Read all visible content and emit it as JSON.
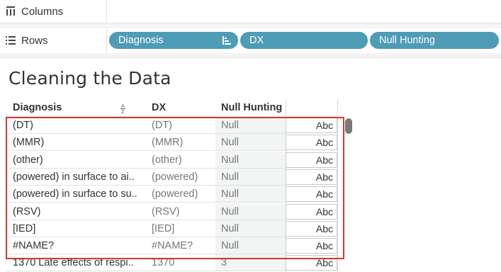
{
  "shelves": {
    "columns": {
      "label": "Columns",
      "icon": "columns-icon"
    },
    "rows": {
      "label": "Rows",
      "icon": "rows-icon",
      "pills": [
        {
          "label": "Diagnosis",
          "icon": "sort-descending-icon"
        },
        {
          "label": "DX"
        },
        {
          "label": "Null Hunting"
        }
      ]
    }
  },
  "sheet": {
    "title": "Cleaning the Data",
    "headers": {
      "diagnosis": "Diagnosis",
      "dx": "DX",
      "null_hunting": "Null Hunting",
      "sort_icon": "sort-az-icon"
    },
    "rows": [
      {
        "diagnosis": "(DT)",
        "dx": "(DT)",
        "null_hunting": "Null",
        "abc": "Abc"
      },
      {
        "diagnosis": "(MMR)",
        "dx": "(MMR)",
        "null_hunting": "Null",
        "abc": "Abc"
      },
      {
        "diagnosis": "(other)",
        "dx": "(other)",
        "null_hunting": "Null",
        "abc": "Abc"
      },
      {
        "diagnosis": "(powered) in surface to ai..",
        "dx": "(powered)",
        "null_hunting": "Null",
        "abc": "Abc"
      },
      {
        "diagnosis": "(powered) in surface to su..",
        "dx": "(powered)",
        "null_hunting": "Null",
        "abc": "Abc"
      },
      {
        "diagnosis": "(RSV)",
        "dx": "(RSV)",
        "null_hunting": "Null",
        "abc": "Abc"
      },
      {
        "diagnosis": "[IED]",
        "dx": "[IED]",
        "null_hunting": "Null",
        "abc": "Abc"
      },
      {
        "diagnosis": "#NAME?",
        "dx": "#NAME?",
        "null_hunting": "Null",
        "abc": "Abc"
      },
      {
        "diagnosis": "1370 Late effects of respi..",
        "dx": "1370",
        "null_hunting": "3",
        "abc": "Abc"
      }
    ]
  },
  "colors": {
    "pill": "#4e9cb6",
    "selection": "#d43a2f",
    "null_fill": "#f3f4f4"
  }
}
